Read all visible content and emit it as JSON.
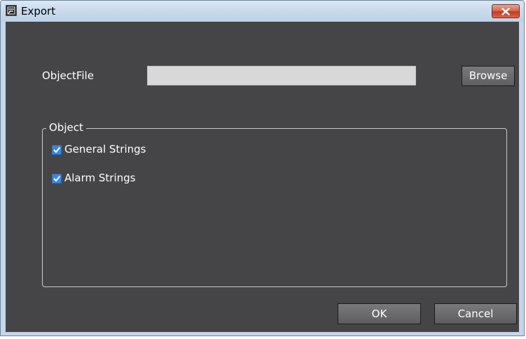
{
  "window": {
    "title": "Export"
  },
  "form": {
    "object_file_label": "ObjectFile",
    "object_file_value": "",
    "browse_label": "Browse"
  },
  "group": {
    "title": "Object",
    "items": [
      {
        "label": "General Strings",
        "checked": true
      },
      {
        "label": "Alarm Strings",
        "checked": true
      }
    ]
  },
  "footer": {
    "ok_label": "OK",
    "cancel_label": "Cancel"
  },
  "colors": {
    "client_bg": "#454547",
    "checkbox_accent": "#3b87e3",
    "close_red": "#c43b21"
  },
  "icons": {
    "app": "app-window-icon",
    "close": "close-icon",
    "check": "checkmark-icon"
  }
}
